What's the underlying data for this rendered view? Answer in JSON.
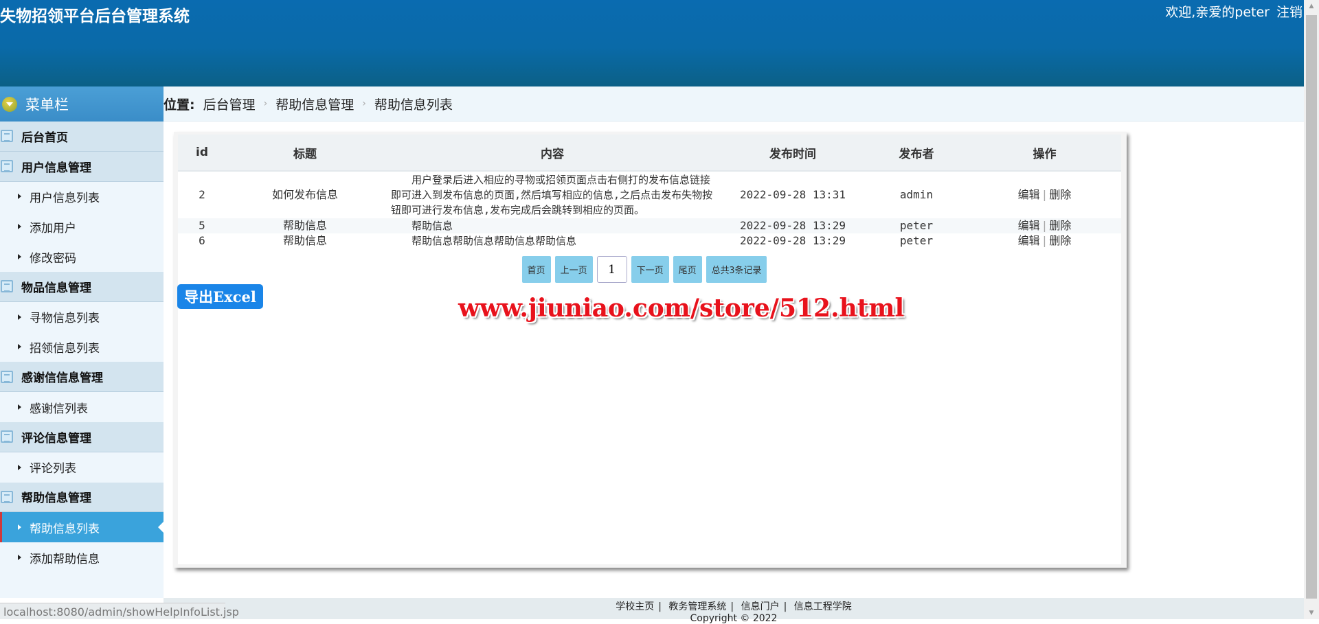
{
  "header": {
    "title": "失物招领平台后台管理系统",
    "welcome": "欢迎,亲爱的peter",
    "logout": "注销"
  },
  "sidebar": {
    "title": "菜单栏",
    "groups": [
      {
        "label": "后台首页",
        "items": []
      },
      {
        "label": "用户信息管理",
        "items": [
          "用户信息列表",
          "添加用户",
          "修改密码"
        ]
      },
      {
        "label": "物品信息管理",
        "items": [
          "寻物信息列表",
          "招领信息列表"
        ]
      },
      {
        "label": "感谢信信息管理",
        "items": [
          "感谢信列表"
        ]
      },
      {
        "label": "评论信息管理",
        "items": [
          "评论列表"
        ]
      },
      {
        "label": "帮助信息管理",
        "items": [
          "帮助信息列表",
          "添加帮助信息"
        ]
      }
    ],
    "active": "帮助信息列表"
  },
  "breadcrumb": {
    "label": "位置:",
    "items": [
      "后台管理",
      "帮助信息管理",
      "帮助信息列表"
    ]
  },
  "table": {
    "columns": [
      "id",
      "标题",
      "内容",
      "发布时间",
      "发布者",
      "操作"
    ],
    "rows": [
      {
        "id": "2",
        "title": "如何发布信息",
        "content": "　　用户登录后进入相应的寻物或招领页面点击右侧打的发布信息链接即可进入到发布信息的页面,然后填写相应的信息,之后点击发布失物按钮即可进行发布信息,发布完成后会跳转到相应的页面。",
        "time": "2022-09-28 13:31",
        "author": "admin"
      },
      {
        "id": "5",
        "title": "帮助信息",
        "content": "　　帮助信息",
        "time": "2022-09-28 13:29",
        "author": "peter"
      },
      {
        "id": "6",
        "title": "帮助信息",
        "content": "　　帮助信息帮助信息帮助信息帮助信息",
        "time": "2022-09-28 13:29",
        "author": "peter"
      }
    ],
    "edit": "编辑",
    "delete": "删除"
  },
  "pager": {
    "first": "首页",
    "prev": "上一页",
    "page": "1",
    "next": "下一页",
    "last": "尾页",
    "total": "总共3条记录"
  },
  "export_label": "导出Excel",
  "watermark": "www.jiuniao.com/store/512.html",
  "footer": {
    "links": [
      "学校主页",
      "教务管理系统",
      "信息门户",
      "信息工程学院"
    ],
    "copyright": "Copyright © 2022"
  },
  "status_url": "localhost:8080/admin/showHelpInfoList.jsp"
}
